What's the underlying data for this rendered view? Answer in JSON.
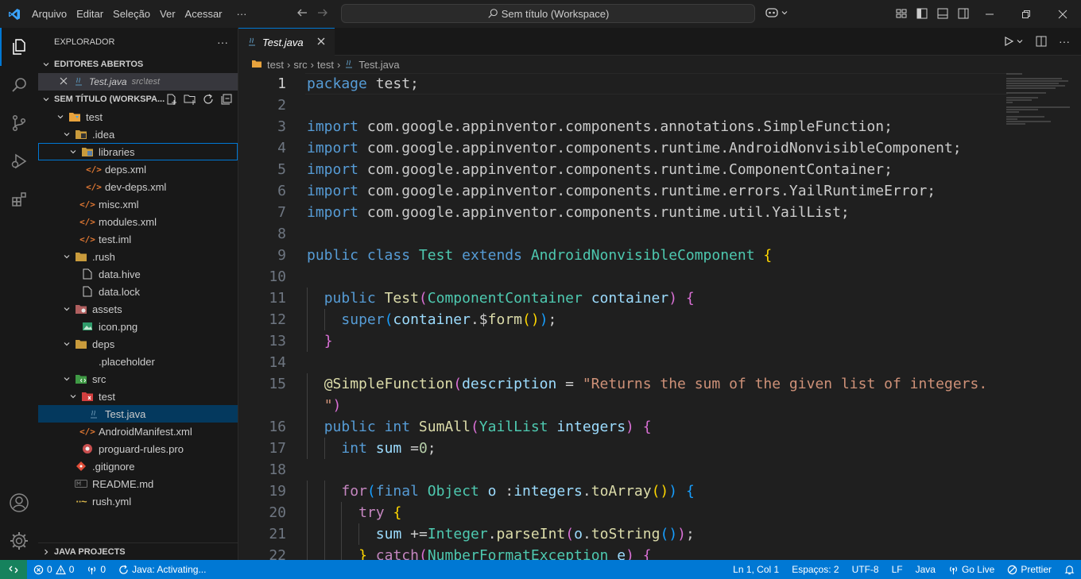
{
  "menu": [
    "Arquivo",
    "Editar",
    "Seleção",
    "Ver",
    "Acessar",
    "···"
  ],
  "command_center": "Sem título (Workspace)",
  "explorer": {
    "title": "EXPLORADOR",
    "more": "···",
    "open_editors_header": "EDITORES ABERTOS",
    "open_editor": {
      "name": "Test.java",
      "path": "src\\test"
    },
    "workspace_header": "SEM TÍTULO (WORKSPA...",
    "java_projects": "JAVA PROJECTS"
  },
  "tree": [
    {
      "label": "test",
      "depth": 0,
      "chev": "⌄",
      "icon": "folder-root"
    },
    {
      "label": ".idea",
      "depth": 1,
      "chev": "⌄",
      "icon": "folder-idea"
    },
    {
      "label": "libraries",
      "depth": 2,
      "chev": "⌄",
      "icon": "folder-lib",
      "focused": true
    },
    {
      "label": "deps.xml",
      "depth": 3,
      "chev": "",
      "icon": "xml"
    },
    {
      "label": "dev-deps.xml",
      "depth": 3,
      "chev": "",
      "icon": "xml"
    },
    {
      "label": "misc.xml",
      "depth": 2,
      "chev": "",
      "icon": "xml"
    },
    {
      "label": "modules.xml",
      "depth": 2,
      "chev": "",
      "icon": "xml"
    },
    {
      "label": "test.iml",
      "depth": 2,
      "chev": "",
      "icon": "xml"
    },
    {
      "label": ".rush",
      "depth": 1,
      "chev": "⌄",
      "icon": "folder"
    },
    {
      "label": "data.hive",
      "depth": 2,
      "chev": "",
      "icon": "file"
    },
    {
      "label": "data.lock",
      "depth": 2,
      "chev": "",
      "icon": "file"
    },
    {
      "label": "assets",
      "depth": 1,
      "chev": "⌄",
      "icon": "folder-assets"
    },
    {
      "label": "icon.png",
      "depth": 2,
      "chev": "",
      "icon": "image"
    },
    {
      "label": "deps",
      "depth": 1,
      "chev": "⌄",
      "icon": "folder"
    },
    {
      "label": ".placeholder",
      "depth": 2,
      "chev": "",
      "icon": "none"
    },
    {
      "label": "src",
      "depth": 1,
      "chev": "⌄",
      "icon": "folder-src"
    },
    {
      "label": "test",
      "depth": 2,
      "chev": "⌄",
      "icon": "folder-test"
    },
    {
      "label": "Test.java",
      "depth": 3,
      "chev": "",
      "icon": "java",
      "selected": true
    },
    {
      "label": "AndroidManifest.xml",
      "depth": 2,
      "chev": "",
      "icon": "xml"
    },
    {
      "label": "proguard-rules.pro",
      "depth": 2,
      "chev": "",
      "icon": "pro"
    },
    {
      "label": ".gitignore",
      "depth": 1,
      "chev": "",
      "icon": "git"
    },
    {
      "label": "README.md",
      "depth": 1,
      "chev": "",
      "icon": "md"
    },
    {
      "label": "rush.yml",
      "depth": 1,
      "chev": "",
      "icon": "yml"
    }
  ],
  "tab": {
    "name": "Test.java"
  },
  "breadcrumb": [
    "test",
    "src",
    "test",
    "Test.java"
  ],
  "code": [
    {
      "n": "1",
      "indent": 0,
      "tokens": [
        [
          "k",
          "package"
        ],
        [
          "",
          "test;"
        ]
      ]
    },
    {
      "n": "2",
      "indent": 0,
      "tokens": []
    },
    {
      "n": "3",
      "indent": 0,
      "tokens": [
        [
          "k",
          "import"
        ],
        [
          "",
          "com.google.appinventor.components.annotations.SimpleFunction;"
        ]
      ]
    },
    {
      "n": "4",
      "indent": 0,
      "tokens": [
        [
          "k",
          "import"
        ],
        [
          "",
          "com.google.appinventor.components.runtime.AndroidNonvisibleComponent;"
        ]
      ]
    },
    {
      "n": "5",
      "indent": 0,
      "tokens": [
        [
          "k",
          "import"
        ],
        [
          "",
          "com.google.appinventor.components.runtime.ComponentContainer;"
        ]
      ]
    },
    {
      "n": "6",
      "indent": 0,
      "tokens": [
        [
          "k",
          "import"
        ],
        [
          "",
          "com.google.appinventor.components.runtime.errors.YailRuntimeError;"
        ]
      ]
    },
    {
      "n": "7",
      "indent": 0,
      "tokens": [
        [
          "k",
          "import"
        ],
        [
          "",
          "com.google.appinventor.components.runtime.util.YailList;"
        ]
      ]
    },
    {
      "n": "8",
      "indent": 0,
      "tokens": []
    },
    {
      "n": "9",
      "indent": 0,
      "tokens": [
        [
          "k",
          "public"
        ],
        [
          "k",
          "class"
        ],
        [
          "t",
          "Test"
        ],
        [
          "k",
          "extends"
        ],
        [
          "t",
          "AndroidNonvisibleComponent"
        ],
        [
          "b1",
          "{"
        ]
      ]
    },
    {
      "n": "10",
      "indent": 0,
      "tokens": []
    },
    {
      "n": "11",
      "indent": 2,
      "tokens": [
        [
          "k",
          "public"
        ],
        [
          "f",
          "Test"
        ],
        [
          "b2",
          "(",
          "nospace"
        ],
        [
          "t",
          "ComponentContainer",
          "nospace"
        ],
        [
          "v",
          "container"
        ],
        [
          "b2",
          ")",
          "nospace"
        ],
        [
          "b2",
          "{"
        ]
      ]
    },
    {
      "n": "12",
      "indent": 4,
      "tokens": [
        [
          "k",
          "super"
        ],
        [
          "b3",
          "(",
          "nospace"
        ],
        [
          "v",
          "container",
          "nospace"
        ],
        [
          "",
          ".$",
          "nospace"
        ],
        [
          "f",
          "form",
          "nospace"
        ],
        [
          "b1",
          "()",
          "nospace"
        ],
        [
          "b3",
          ")",
          "nospace"
        ],
        [
          "",
          ";",
          "nospace"
        ]
      ]
    },
    {
      "n": "13",
      "indent": 2,
      "tokens": [
        [
          "b2",
          "}"
        ]
      ]
    },
    {
      "n": "14",
      "indent": 0,
      "tokens": []
    },
    {
      "n": "15",
      "indent": 2,
      "tokens": [
        [
          "f",
          "@SimpleFunction"
        ],
        [
          "b2",
          "(",
          "nospace"
        ],
        [
          "v",
          "description",
          "nospace"
        ],
        [
          "",
          "="
        ],
        [
          "s",
          "\"Returns the sum of the given list of integers."
        ]
      ]
    },
    {
      "n": "",
      "indent": 2,
      "tokens": [
        [
          "s",
          "\""
        ],
        [
          "b2",
          ")",
          "nospace"
        ]
      ]
    },
    {
      "n": "16",
      "indent": 2,
      "tokens": [
        [
          "k",
          "public"
        ],
        [
          "k",
          "int"
        ],
        [
          "f",
          "SumAll"
        ],
        [
          "b2",
          "(",
          "nospace"
        ],
        [
          "t",
          "YailList",
          "nospace"
        ],
        [
          "v",
          "integers"
        ],
        [
          "b2",
          ")",
          "nospace"
        ],
        [
          "b2",
          "{"
        ]
      ]
    },
    {
      "n": "17",
      "indent": 4,
      "tokens": [
        [
          "k",
          "int"
        ],
        [
          "v",
          "sum"
        ],
        [
          "",
          "="
        ],
        [
          "n",
          "0",
          "nospace"
        ],
        [
          "",
          ";",
          "nospace"
        ]
      ]
    },
    {
      "n": "18",
      "indent": 0,
      "tokens": []
    },
    {
      "n": "19",
      "indent": 4,
      "tokens": [
        [
          "kc",
          "for"
        ],
        [
          "b3",
          "(",
          "nospace"
        ],
        [
          "k",
          "final",
          "nospace"
        ],
        [
          "t",
          "Object"
        ],
        [
          "v",
          "o"
        ],
        [
          "",
          ":"
        ],
        [
          "v",
          "integers",
          "nospace"
        ],
        [
          "",
          ".",
          "nospace"
        ],
        [
          "f",
          "toArray",
          "nospace"
        ],
        [
          "b1",
          "()",
          "nospace"
        ],
        [
          "b3",
          ")",
          "nospace"
        ],
        [
          "b3",
          "{"
        ]
      ]
    },
    {
      "n": "20",
      "indent": 6,
      "tokens": [
        [
          "kc",
          "try"
        ],
        [
          "b1",
          "{"
        ]
      ]
    },
    {
      "n": "21",
      "indent": 8,
      "tokens": [
        [
          "v",
          "sum"
        ],
        [
          "",
          "+="
        ],
        [
          "t",
          "Integer",
          "nospace"
        ],
        [
          "",
          ".",
          "nospace"
        ],
        [
          "f",
          "parseInt",
          "nospace"
        ],
        [
          "b2",
          "(",
          "nospace"
        ],
        [
          "v",
          "o",
          "nospace"
        ],
        [
          "",
          ".",
          "nospace"
        ],
        [
          "f",
          "toString",
          "nospace"
        ],
        [
          "b3",
          "()",
          "nospace"
        ],
        [
          "b2",
          ")",
          "nospace"
        ],
        [
          "",
          ";",
          "nospace"
        ]
      ]
    },
    {
      "n": "22",
      "indent": 6,
      "tokens": [
        [
          "b1",
          "}"
        ],
        [
          "kc",
          "catch"
        ],
        [
          "b2",
          "(",
          "nospace"
        ],
        [
          "t",
          "NumberFormatException",
          "nospace"
        ],
        [
          "v",
          "e"
        ],
        [
          "b2",
          ")",
          "nospace"
        ],
        [
          "b2",
          "{"
        ]
      ]
    }
  ],
  "status": {
    "errors": "0",
    "warnings": "0",
    "ports": "0",
    "java": "Java: Activating...",
    "position": "Ln 1, Col 1",
    "spaces": "Espaços: 2",
    "encoding": "UTF-8",
    "eol": "LF",
    "language": "Java",
    "golive": "Go Live",
    "prettier": "Prettier"
  },
  "colors": {
    "accent": "#0078d4",
    "remote": "#16825d",
    "selection": "#04395e"
  }
}
